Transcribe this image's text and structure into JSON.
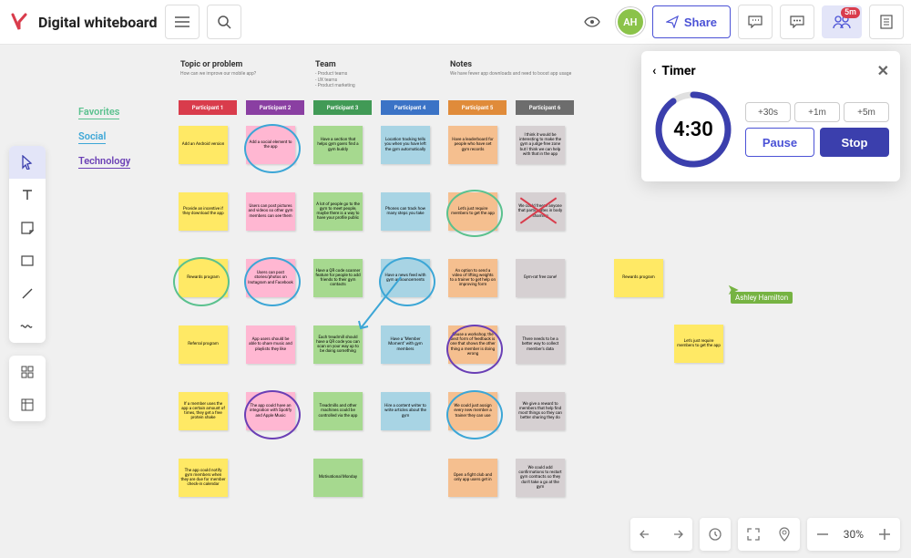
{
  "header": {
    "title": "Digital whiteboard",
    "avatar": "AH",
    "share": "Share",
    "collab_badge": "5m"
  },
  "timer": {
    "title": "Timer",
    "value": "4:30",
    "inc": [
      "+30s",
      "+1m",
      "+5m"
    ],
    "pause": "Pause",
    "stop": "Stop"
  },
  "legend": {
    "fav": "Favorites",
    "soc": "Social",
    "tech": "Technology"
  },
  "sections": {
    "topic_h": "Topic or problem",
    "topic_s": "How can we improve our mobile app?",
    "team_h": "Team",
    "team_s": "- Product teams\n- UX teams\n- Product marketing",
    "notes_h": "Notes",
    "notes_s": "We have fewer app downloads and need to boost app usage"
  },
  "participants": [
    "Participant 1",
    "Participant 2",
    "Participant 3",
    "Participant 4",
    "Participant 5",
    "Participant 6"
  ],
  "pcolors": [
    "#d93c4c",
    "#8a3fa2",
    "#419a56",
    "#3b73c6",
    "#e08b3a",
    "#6d6d6d"
  ],
  "grid": [
    [
      "Add an Android version",
      "Add a social element to the app",
      "Have a section that helps gym goers find a gym buddy",
      "Location tracking tells you when you have left the gym automatically",
      "Have a leaderboard for people who have set gym records",
      "I think it would be interesting to make the gym a judge-free zone but I think we can help with that in the app"
    ],
    [
      "Provide an incentive if they download the app",
      "Users can post pictures and videos so other gym members can see them",
      "A lot of people go to the gym to meet people, maybe there is a way to have your profile public",
      "Phones can track how many steps you take",
      "Let's just require members to get the app",
      "We could freeze anyone that participates in body shaming"
    ],
    [
      "Rewards program",
      "Users can post stories/photos on Instagram and Facebook",
      "Have a QR code scanner feature for people to add friends to their gym contacts",
      "Have a news feed with gym announcements",
      "An option to send a video of lifting weights to a trainer to get help on improving form",
      "Gym-rat free zone!"
    ],
    [
      "Referral program",
      "App users should be able to share music and playlists they like",
      "Each treadmill should have a QR code you can scan on your way up to be doing something",
      "Have a \"Member Moment\" with gym members",
      "Cause a workshop; the best form of feedback is one that shows the other thing a member is doing wrong",
      "There needs to be a better way to collect member's data"
    ],
    [
      "If a member uses the app a certain amount of times, they get a free protein shake",
      "The app could have an integration with Spotify and Apple Music",
      "Treadmills and other machines could be controlled via the app",
      "Hire a content writer to write articles about the gym",
      "We could just assign every new member a trainer they can use",
      "We give a reward to members that help find most things so they can better sharing they do"
    ],
    [
      "The app could notify gym members when they are due for member check-in calendar",
      "",
      "Motivational Monday",
      "",
      "Open a fight club and only app users get in",
      "We could add confirmations to restart gym contracts so they don't take a go at the gym"
    ]
  ],
  "floaters": {
    "rewards": "Rewards program",
    "require": "Let's just require members to get the app"
  },
  "cursor_name": "Ashley Hamilton",
  "zoom": "30%"
}
